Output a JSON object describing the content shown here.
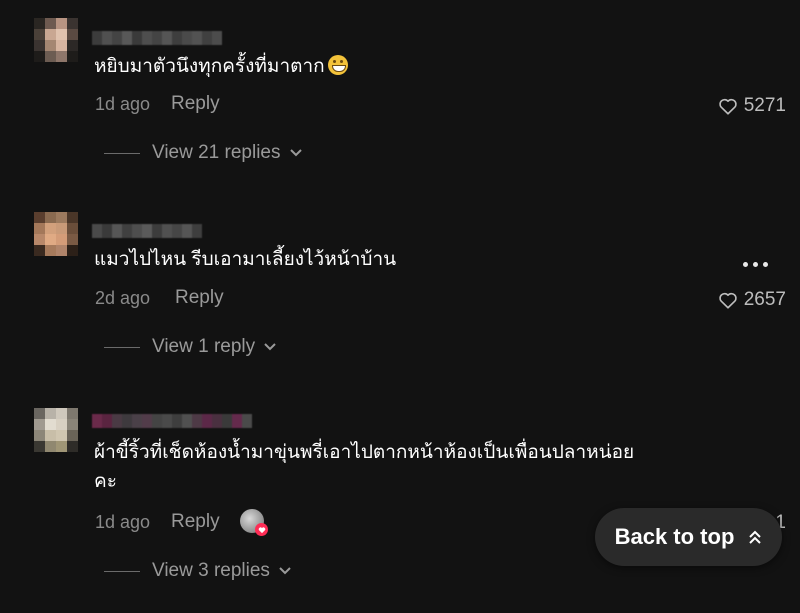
{
  "comments": [
    {
      "text": "หยิบมาตัวนึงทุกครั้งที่มาตาก",
      "emoji": "grinning-face-emoji",
      "time": "1d ago",
      "reply_label": "Reply",
      "likes": "5271",
      "view_replies": "View 21 replies"
    },
    {
      "text": "แมวไปไหน รีบเอามาเลี้ยงไว้หน้าบ้าน",
      "time": "2d ago",
      "reply_label": "Reply",
      "likes": "2657",
      "view_replies": "View 1 reply"
    },
    {
      "text_line1": "ผ้าขี้ริ้วที่เช็ดห้องน้ำมาขุ่นพรี่เอาไปตากหน้าห้องเป็นเพื่อนปลาหน่อย",
      "text_line2": "คะ",
      "time": "1d ago",
      "reply_label": "Reply",
      "likes_partial": "1",
      "view_replies": "View 3 replies"
    }
  ],
  "back_to_top": {
    "label": "Back to top"
  },
  "colors": {
    "background": "#121212",
    "text_primary": "#ffffff",
    "text_secondary": "#8a8a8a",
    "creator_heart": "#fe2c55",
    "button_bg": "#2a2a2a"
  },
  "icons": [
    "heart-icon",
    "chevron-down-icon",
    "more-icon",
    "chevron-double-up-icon"
  ]
}
